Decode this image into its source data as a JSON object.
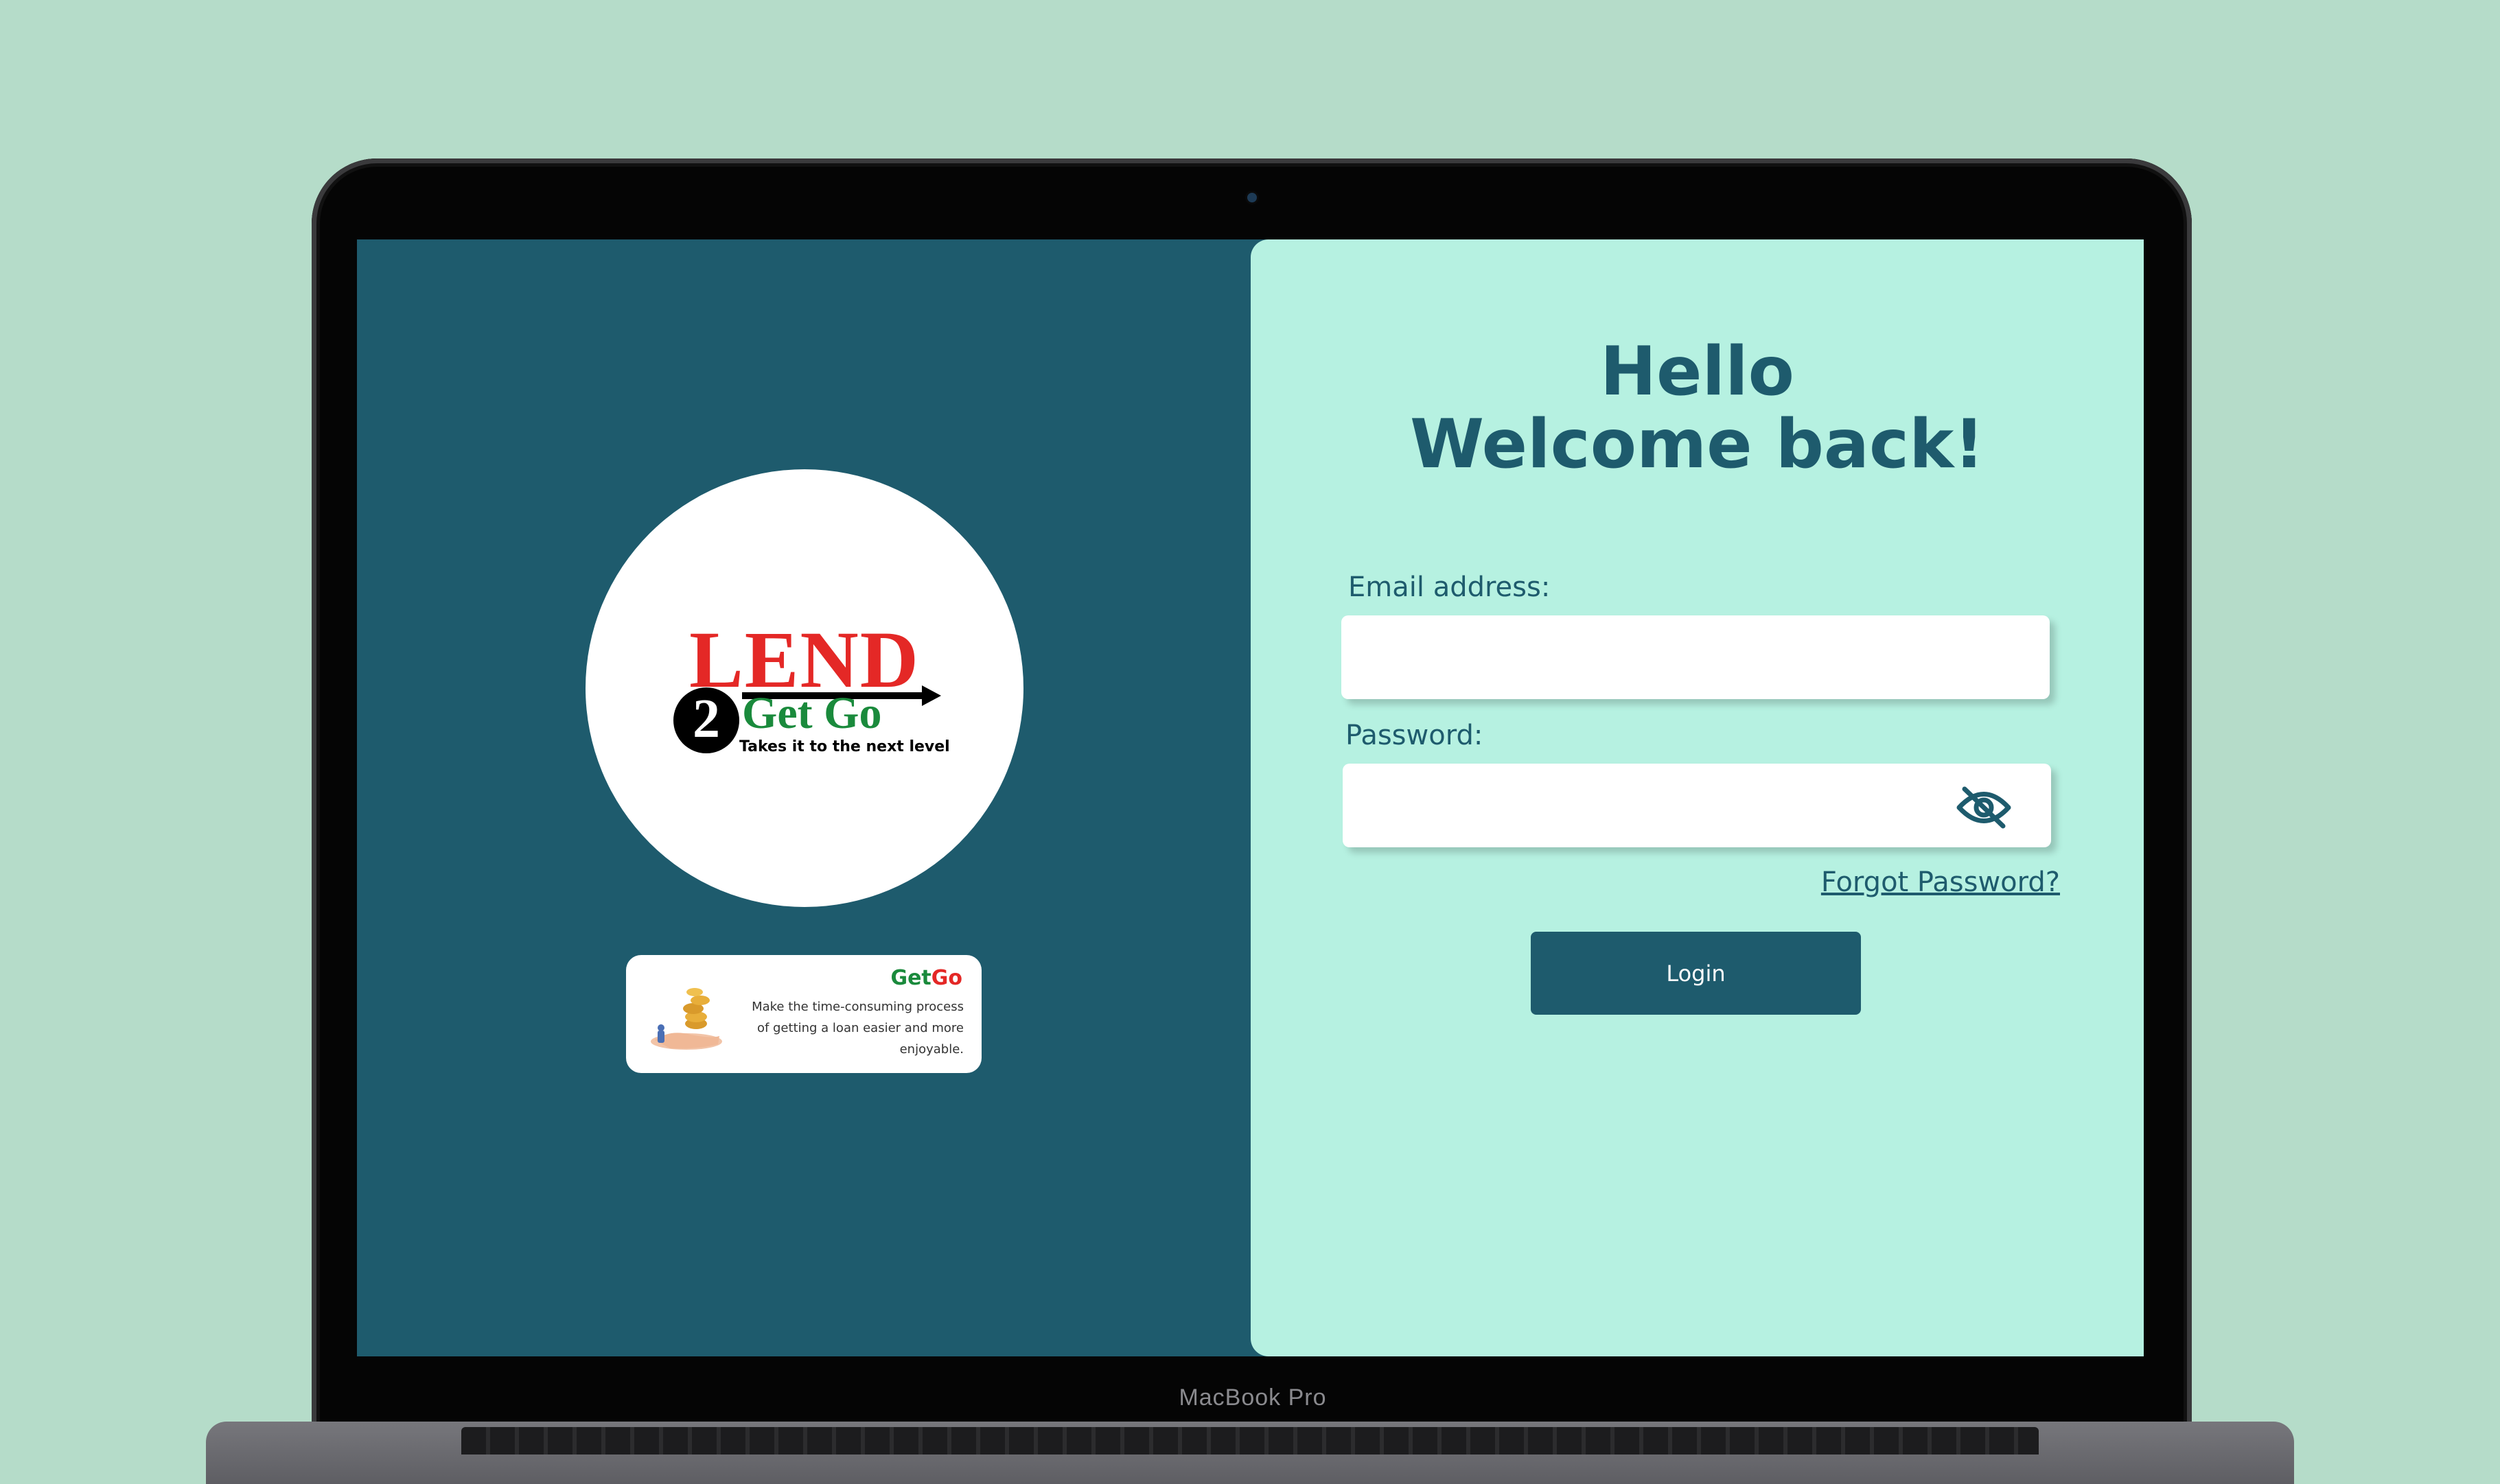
{
  "device": {
    "label": "MacBook Pro"
  },
  "brand": {
    "logo_word": "LEND",
    "logo_numeral": "2",
    "logo_name": "Get Go",
    "logo_tagline": "Takes it to the next level"
  },
  "promo": {
    "brand_part1": "Get",
    "brand_part2": "Go",
    "description": "Make the time-consuming process of getting a loan easier and more enjoyable."
  },
  "login": {
    "greeting_line1": "Hello",
    "greeting_line2": "Welcome back!",
    "email_label": "Email address:",
    "email_value": "",
    "password_label": "Password:",
    "password_value": "",
    "forgot_link": "Forgot Password?",
    "submit_label": "Login"
  },
  "icons": {
    "password_toggle": "eye-off-icon"
  },
  "colors": {
    "panel_dark": "#1e5b6d",
    "panel_light": "#b6f1e1",
    "brand_red": "#e42826",
    "brand_green": "#1a8a3c",
    "page_bg": "#b5dcc9"
  }
}
